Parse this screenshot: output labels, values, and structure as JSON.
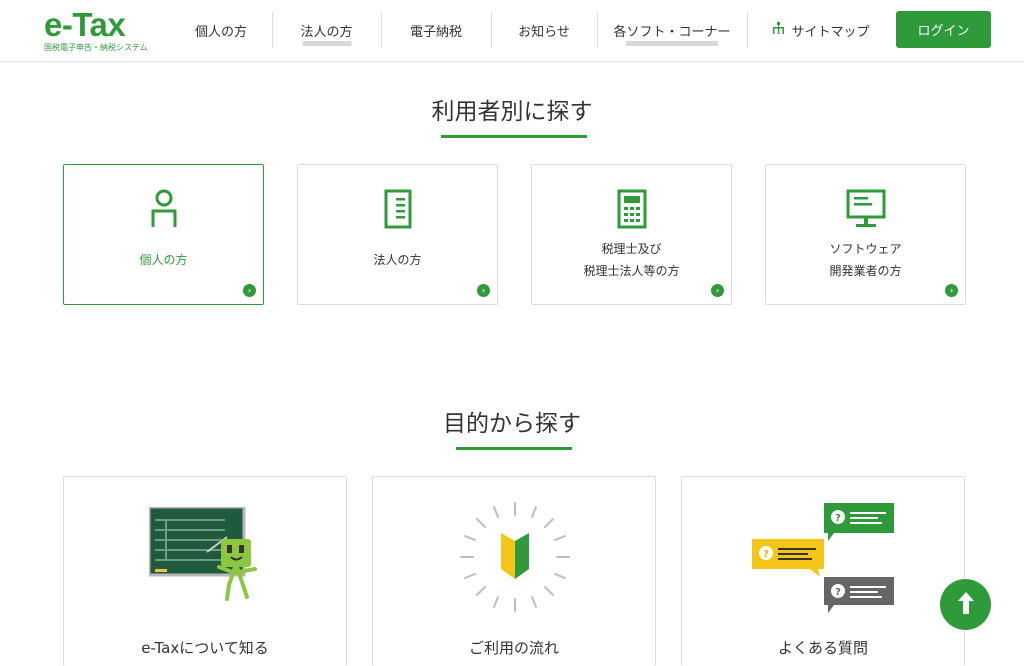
{
  "logo": {
    "main": "e-Tax",
    "sub": "国税電子申告・納税システム"
  },
  "nav": [
    {
      "label": "個人の方",
      "underline": false
    },
    {
      "label": "法人の方",
      "underline": true
    },
    {
      "label": "電子納税",
      "underline": false
    },
    {
      "label": "お知らせ",
      "underline": false
    },
    {
      "label": "各ソフト・コーナー",
      "underline": true
    },
    {
      "label": "サイトマップ",
      "icon": "sitemap-icon"
    }
  ],
  "login": "ログイン",
  "section_user": {
    "title": "利用者別に探す",
    "cards": [
      {
        "line1": "個人の方",
        "line2": "",
        "icon": "person-icon"
      },
      {
        "line1": "法人の方",
        "line2": "",
        "icon": "building-icon"
      },
      {
        "line1": "税理士及び",
        "line2": "税理士法人等の方",
        "icon": "calculator-icon"
      },
      {
        "line1": "ソフトウェア",
        "line2": "開発業者の方",
        "icon": "monitor-icon"
      }
    ]
  },
  "section_purpose": {
    "title": "目的から探す",
    "cards": [
      {
        "label": "e-Taxについて知る",
        "icon": "blackboard-character-icon"
      },
      {
        "label": "ご利用の流れ",
        "icon": "beginner-mark-icon"
      },
      {
        "label": "よくある質問",
        "icon": "faq-bubbles-icon"
      }
    ]
  },
  "colors": {
    "accent": "#2e9a3a",
    "yellow": "#f5c518",
    "gray": "#666666"
  }
}
